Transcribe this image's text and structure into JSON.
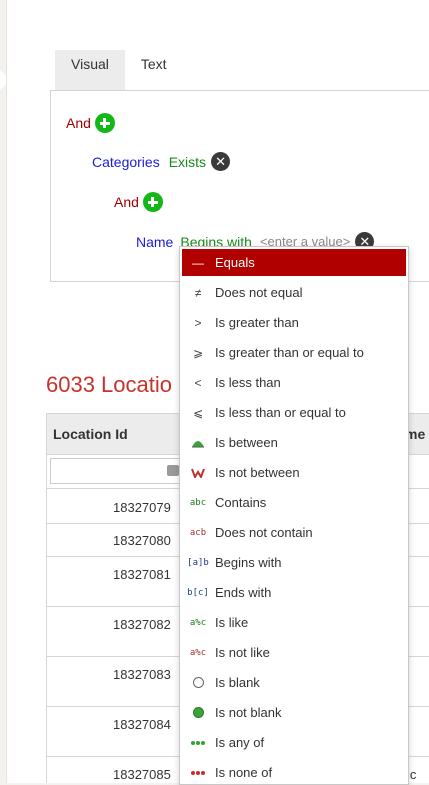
{
  "tabs": [
    {
      "label": "Visual",
      "active": true
    },
    {
      "label": "Text",
      "active": false
    }
  ],
  "builder": {
    "root_operator": "And",
    "condition1": {
      "field": "Categories",
      "operator": "Exists"
    },
    "nested_operator": "And",
    "condition2": {
      "field": "Name",
      "operator": "Begins with",
      "placeholder": "<enter a value>"
    }
  },
  "results_title": "6033 Locatio",
  "grid": {
    "columns": [
      "Location Id",
      "me"
    ],
    "rows": [
      {
        "id": "18327079",
        "extra": ""
      },
      {
        "id": "18327080",
        "extra": ""
      },
      {
        "id": "18327081",
        "extra": ""
      },
      {
        "id": "18327082",
        "extra": ""
      },
      {
        "id": "18327083",
        "extra": ""
      },
      {
        "id": "18327084",
        "extra": ""
      },
      {
        "id": "18327085",
        "extra": "ic"
      }
    ]
  },
  "operator_menu": {
    "items": [
      {
        "label": "Equals",
        "icon": "equals-icon",
        "glyph": "=",
        "selected": true
      },
      {
        "label": "Does not equal",
        "icon": "not-equal-icon",
        "glyph": "≠"
      },
      {
        "label": "Is greater than",
        "icon": "greater-than-icon",
        "glyph": ">"
      },
      {
        "label": "Is greater than or equal to",
        "icon": "greater-equal-icon",
        "glyph": "⩾"
      },
      {
        "label": "Is less than",
        "icon": "less-than-icon",
        "glyph": "<"
      },
      {
        "label": "Is less than or equal to",
        "icon": "less-equal-icon",
        "glyph": "⩽"
      },
      {
        "label": "Is between",
        "icon": "between-icon",
        "glyph": ""
      },
      {
        "label": "Is not between",
        "icon": "not-between-icon",
        "glyph": ""
      },
      {
        "label": "Contains",
        "icon": "contains-icon",
        "glyph": "abc"
      },
      {
        "label": "Does not contain",
        "icon": "not-contain-icon",
        "glyph": "acb"
      },
      {
        "label": "Begins with",
        "icon": "begins-with-icon",
        "glyph": "[a]b"
      },
      {
        "label": "Ends with",
        "icon": "ends-with-icon",
        "glyph": "b[c]"
      },
      {
        "label": "Is like",
        "icon": "like-icon",
        "glyph": "a%c"
      },
      {
        "label": "Is not like",
        "icon": "not-like-icon",
        "glyph": "a%c"
      },
      {
        "label": "Is blank",
        "icon": "blank-icon",
        "glyph": ""
      },
      {
        "label": "Is not blank",
        "icon": "not-blank-icon",
        "glyph": ""
      },
      {
        "label": "Is any of",
        "icon": "any-of-icon",
        "glyph": ""
      },
      {
        "label": "Is none of",
        "icon": "none-of-icon",
        "glyph": ""
      }
    ]
  },
  "colors": {
    "accent_red": "#b00000",
    "and_red": "#a00000",
    "field_blue": "#1c1cd8",
    "operator_green": "#1b8a1b",
    "title_red": "#c8322b",
    "add_green": "#13b818"
  }
}
